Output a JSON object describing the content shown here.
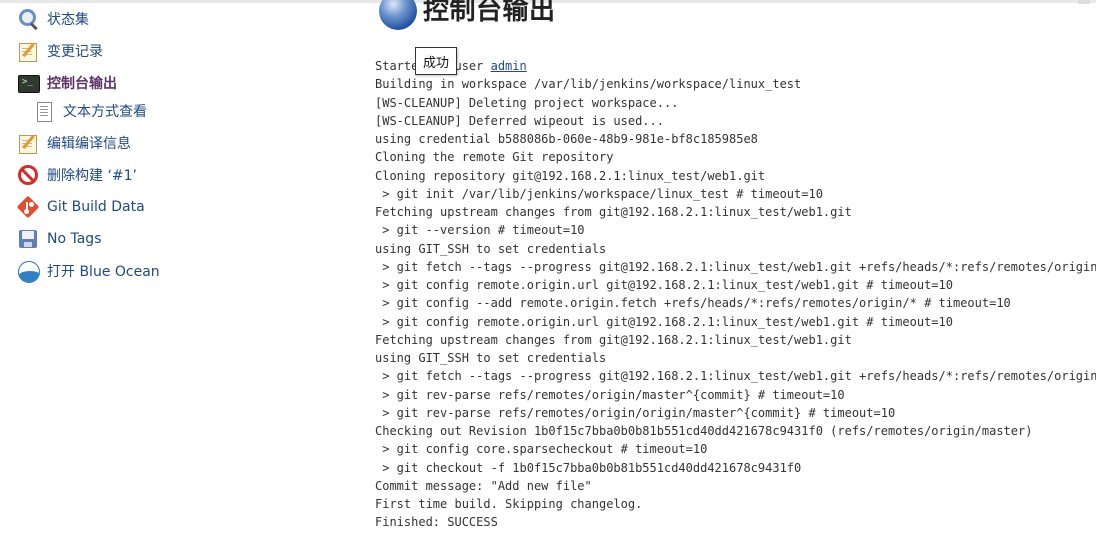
{
  "sidebar": {
    "items": [
      {
        "label": "状态集",
        "icon": "search-icon"
      },
      {
        "label": "变更记录",
        "icon": "notepad-icon"
      },
      {
        "label": "控制台输出",
        "icon": "terminal-icon",
        "active": true
      },
      {
        "label": "文本方式查看",
        "icon": "document-icon",
        "sub": true
      },
      {
        "label": "编辑编译信息",
        "icon": "notepad-icon"
      },
      {
        "label": "删除构建 ‘#1’",
        "icon": "delete-icon"
      },
      {
        "label": "Git Build Data",
        "icon": "git-icon"
      },
      {
        "label": "No Tags",
        "icon": "floppy-icon"
      },
      {
        "label": "打开 Blue Ocean",
        "icon": "blue-ocean-icon"
      }
    ]
  },
  "main": {
    "title": "控制台输出",
    "tooltip": "成功",
    "console": {
      "first_line_prefix": "Started by user ",
      "user_link": "admin",
      "lines": [
        "Building in workspace /var/lib/jenkins/workspace/linux_test",
        "[WS-CLEANUP] Deleting project workspace...",
        "[WS-CLEANUP] Deferred wipeout is used...",
        "using credential b588086b-060e-48b9-981e-bf8c185985e8",
        "Cloning the remote Git repository",
        "Cloning repository git@192.168.2.1:linux_test/web1.git",
        " > git init /var/lib/jenkins/workspace/linux_test # timeout=10",
        "Fetching upstream changes from git@192.168.2.1:linux_test/web1.git",
        " > git --version # timeout=10",
        "using GIT_SSH to set credentials",
        " > git fetch --tags --progress git@192.168.2.1:linux_test/web1.git +refs/heads/*:refs/remotes/origin/*",
        " > git config remote.origin.url git@192.168.2.1:linux_test/web1.git # timeout=10",
        " > git config --add remote.origin.fetch +refs/heads/*:refs/remotes/origin/* # timeout=10",
        " > git config remote.origin.url git@192.168.2.1:linux_test/web1.git # timeout=10",
        "Fetching upstream changes from git@192.168.2.1:linux_test/web1.git",
        "using GIT_SSH to set credentials",
        " > git fetch --tags --progress git@192.168.2.1:linux_test/web1.git +refs/heads/*:refs/remotes/origin/*",
        " > git rev-parse refs/remotes/origin/master^{commit} # timeout=10",
        " > git rev-parse refs/remotes/origin/origin/master^{commit} # timeout=10",
        "Checking out Revision 1b0f15c7bba0b0b81b551cd40dd421678c9431f0 (refs/remotes/origin/master)",
        " > git config core.sparsecheckout # timeout=10",
        " > git checkout -f 1b0f15c7bba0b0b81b551cd40dd421678c9431f0",
        "Commit message: \"Add new file\"",
        "First time build. Skipping changelog.",
        "Finished: SUCCESS"
      ]
    }
  }
}
